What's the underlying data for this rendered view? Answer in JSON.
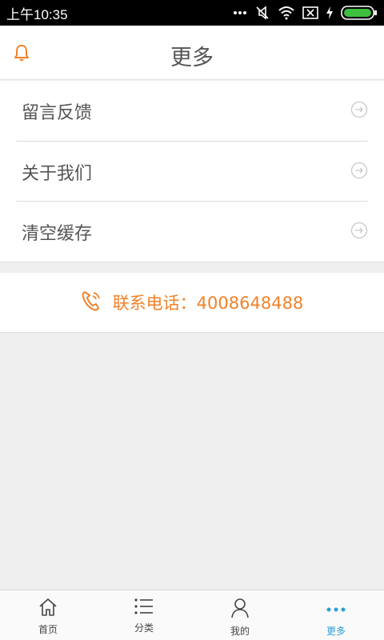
{
  "status_bar": {
    "time": "上午10:35",
    "icons": [
      "more-dots-icon",
      "mute-icon",
      "wifi-icon",
      "sim-x-icon",
      "charging-icon",
      "battery-icon"
    ]
  },
  "header": {
    "title": "更多",
    "left_icon": "bell-icon",
    "accent_color": "#f0822a"
  },
  "menu": {
    "items": [
      {
        "label": "留言反馈",
        "icon": "arrow-circle-right-icon"
      },
      {
        "label": "关于我们",
        "icon": "arrow-circle-right-icon"
      },
      {
        "label": "清空缓存",
        "icon": "arrow-circle-right-icon"
      }
    ]
  },
  "contact": {
    "icon": "phone-icon",
    "text": "联系电话：4008648488",
    "color": "#f0822a"
  },
  "tabbar": {
    "active_color": "#2a9fd8",
    "tabs": [
      {
        "label": "首页",
        "icon": "home-icon",
        "active": false
      },
      {
        "label": "分类",
        "icon": "list-icon",
        "active": false
      },
      {
        "label": "我的",
        "icon": "user-icon",
        "active": false
      },
      {
        "label": "更多",
        "icon": "more-dots-icon",
        "active": true
      }
    ]
  }
}
